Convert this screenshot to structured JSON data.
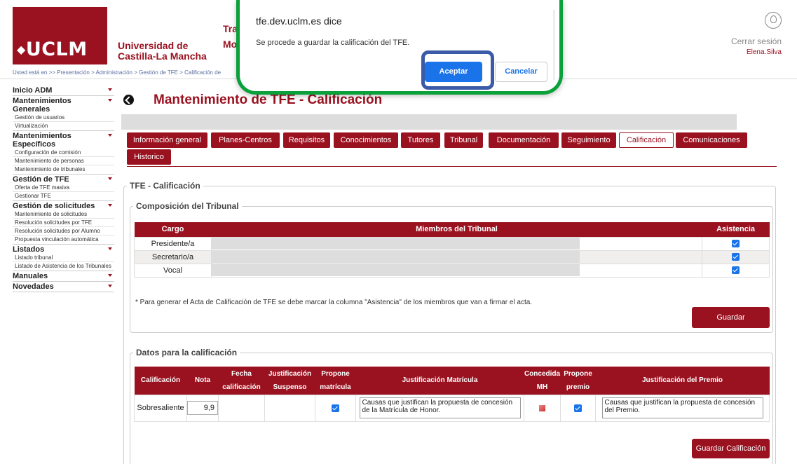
{
  "header": {
    "logo_text": "UCLM",
    "university_line1": "Universidad de",
    "university_line2": "Castilla-La Mancha",
    "app_title_line1": "Tra",
    "app_title_line2": "Mo",
    "breadcrumb": "Usted está en >> Presentación > Administración > Gestión de TFE > Calificación de",
    "logout": "Cerrar sesión",
    "username": "Elena.Silva"
  },
  "sidebar": {
    "groups": [
      {
        "title": "Inicio ADM",
        "items": []
      },
      {
        "title": "Mantenimientos Generales",
        "items": [
          "Gestión de usuarios",
          "Virtualización"
        ]
      },
      {
        "title": "Mantenimientos Específicos",
        "items": [
          "Configuración de comisión",
          "Mantenimiento de personas",
          "Mantenimiento de tribunales"
        ]
      },
      {
        "title": "Gestión de TFE",
        "items": [
          "Oferta de TFE masiva",
          "Gestionar TFE"
        ]
      },
      {
        "title": "Gestión de solicitudes",
        "items": [
          "Mantenimiento de solicitudes",
          "Resolución solicitudes por TFE",
          "Resolución solicitudes por Alumno",
          "Propuesta vinculación automática"
        ]
      },
      {
        "title": "Listados",
        "items": [
          "Listado tribunal",
          "Listado de Asistencia de los Tribunales"
        ]
      },
      {
        "title": "Manuales",
        "items": []
      },
      {
        "title": "Novedades",
        "items": []
      }
    ]
  },
  "main": {
    "title": "Mantenimiento de TFE - Calificación",
    "tabs": [
      "Información general",
      "Planes-Centros",
      "Requisitos",
      "Conocimientos",
      "Tutores",
      "Tribunal",
      "Documentación",
      "Seguimiento",
      "Calificación",
      "Comunicaciones",
      "Historico"
    ],
    "active_tab": "Calificación",
    "section_title": "TFE - Calificación",
    "tribunal": {
      "legend": "Composición del Tribunal",
      "headers": [
        "Cargo",
        "Miembros del Tribunal",
        "Asistencia"
      ],
      "rows": [
        {
          "cargo": "Presidente/a",
          "asistencia": true
        },
        {
          "cargo": "Secretario/a",
          "asistencia": true
        },
        {
          "cargo": "Vocal",
          "asistencia": true
        }
      ],
      "note": "* Para generar el Acta de Calificación de TFE se debe marcar la columna \"Asistencia\" de los miembros que van a firmar el acta.",
      "save_label": "Guardar"
    },
    "datos": {
      "legend": "Datos para la calificación",
      "headers": {
        "calificacion": "Calificación",
        "nota": "Nota",
        "fecha_1": "Fecha",
        "fecha_2": "calificación",
        "just_susp_1": "Justificación",
        "just_susp_2": "Suspenso",
        "propone_mat_1": "Propone",
        "propone_mat_2": "matrícula",
        "just_mat": "Justificación Matrícula",
        "concedida_1": "Concedida",
        "concedida_2": "MH",
        "propone_pre_1": "Propone",
        "propone_pre_2": "premio",
        "just_premio": "Justificación del Premio"
      },
      "row": {
        "calificacion": "Sobresaliente",
        "nota": "9,9",
        "propone_matricula": true,
        "just_matricula": "Causas que justifican la propuesta de concesión de la Matrícula de Honor.",
        "propone_premio": true,
        "just_premio": "Causas que justifican la propuesta de concesión del Premio."
      },
      "save_label": "Guardar Calificación"
    }
  },
  "dialog": {
    "title": "tfe.dev.uclm.es dice",
    "message": "Se procede a guardar la calificación del TFE.",
    "accept": "Aceptar",
    "cancel": "Cancelar"
  },
  "colors": {
    "brand": "#9a1220",
    "highlight_green": "#0aa03a",
    "highlight_blue": "#3b5ba8",
    "primary_button": "#1a73e8"
  }
}
